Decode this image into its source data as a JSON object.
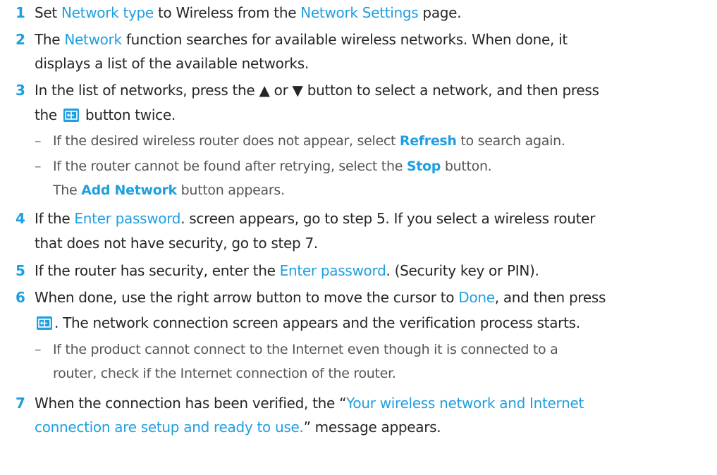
{
  "steps": [
    {
      "num": "1",
      "parts": [
        "Set ",
        "Network type",
        " to Wireless from the ",
        "Network Settings",
        " page."
      ]
    },
    {
      "num": "2",
      "line1": [
        "The ",
        "Network",
        " function searches for available wireless networks. When done, it"
      ],
      "line2": "displays a list of the available networks."
    },
    {
      "num": "3",
      "line1": "In the list of networks, press the ▲ or ▼ button to select a network, and then press",
      "line2a": "the ",
      "line2b": " button twice."
    },
    {
      "num": "4",
      "line1": [
        "If the ",
        "Enter password",
        ". screen appears, go to step 5. If you select a wireless router"
      ],
      "line2": "that does not have security, go to step 7."
    },
    {
      "num": "5",
      "parts": [
        "If the router has security, enter the ",
        "Enter password",
        ". (Security key or PIN)."
      ]
    },
    {
      "num": "6",
      "line1": [
        "When done, use the right arrow button to move the cursor to ",
        "Done",
        ", and then press"
      ],
      "line2": ". The network connection screen appears and the verification process starts."
    },
    {
      "num": "7",
      "line1": [
        "When the connection has been verified, the “",
        "Your wireless network and Internet"
      ],
      "line2": [
        "connection are setup and ready to use.",
        "” message appears."
      ]
    }
  ],
  "notes": {
    "step3": [
      {
        "dash": "–",
        "parts": [
          "If the desired wireless router does not appear, select ",
          "Refresh",
          " to search again."
        ]
      },
      {
        "dash": "–",
        "parts": [
          "If the router cannot be found after retrying, select the ",
          "Stop",
          " button."
        ]
      },
      {
        "parts": [
          "The ",
          "Add Network",
          " button appears."
        ]
      }
    ],
    "step6": [
      {
        "dash": "–",
        "line1": "If the product cannot connect to the Internet even though it is connected to a",
        "line2": "router, check if the Internet connection of the router."
      }
    ]
  },
  "icons": {
    "enter": "enter-button-icon"
  },
  "colors": {
    "accent": "#1e9fe0",
    "text": "#262626",
    "note": "#555555"
  }
}
